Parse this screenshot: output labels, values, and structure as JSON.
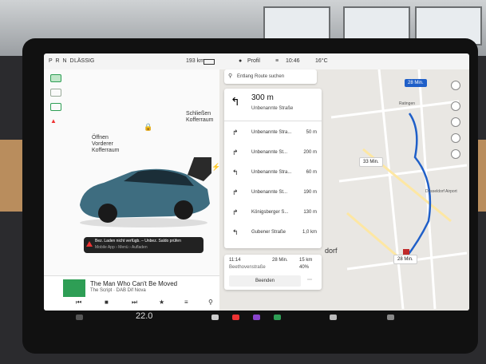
{
  "topbar": {
    "gear": "P R N D",
    "mode": "LÄSSIG",
    "range": "193 km",
    "profile": "Profil",
    "time": "10:46",
    "temp": "16°C"
  },
  "car": {
    "front_trunk": "Öffnen\nVorderer\nKofferraum",
    "rear_trunk": "Schließen\nKofferraum",
    "alert_title": "Bez. Laden nicht verfügb. – Unbez. Saldo prüfen",
    "alert_sub": "Mobile App › Menü › Aufladen"
  },
  "media": {
    "song": "The Man Who Can't Be Moved",
    "artist": "The Script · DAB Dif Nova"
  },
  "map": {
    "search_placeholder": "Entlang Route suchen",
    "first_distance": "300 m",
    "first_street": "Unbenannte Straße",
    "steps": [
      {
        "street": "Unbenannte Stra...",
        "dist": "50 m"
      },
      {
        "street": "Unbenannte St...",
        "dist": "200 m"
      },
      {
        "street": "Unbenannte Stra...",
        "dist": "60 m"
      },
      {
        "street": "Unbenannte St...",
        "dist": "190 m"
      },
      {
        "street": "Königsberger S...",
        "dist": "130 m"
      },
      {
        "street": "Gubener Straße",
        "dist": "1,0 km"
      }
    ],
    "trip_time": "11:14",
    "trip_left": "28 Min.",
    "trip_km": "15 km",
    "trip_battery": "40%",
    "trip_dest": "Beethovenstraße",
    "end_button": "Beenden",
    "eta_top": "28 Min.",
    "eta_mid": "33 Min.",
    "eta_bottom": "28 Min.",
    "place_ratingen": "Ratingen",
    "place_airport": "Düsseldorf Airport",
    "place_duesseldorf": "dorf"
  },
  "climate": {
    "temp": "22.0"
  },
  "colors": {
    "route": "#1f5fc8",
    "accent_green": "#2e9e55",
    "alert_red": "#e33333"
  }
}
